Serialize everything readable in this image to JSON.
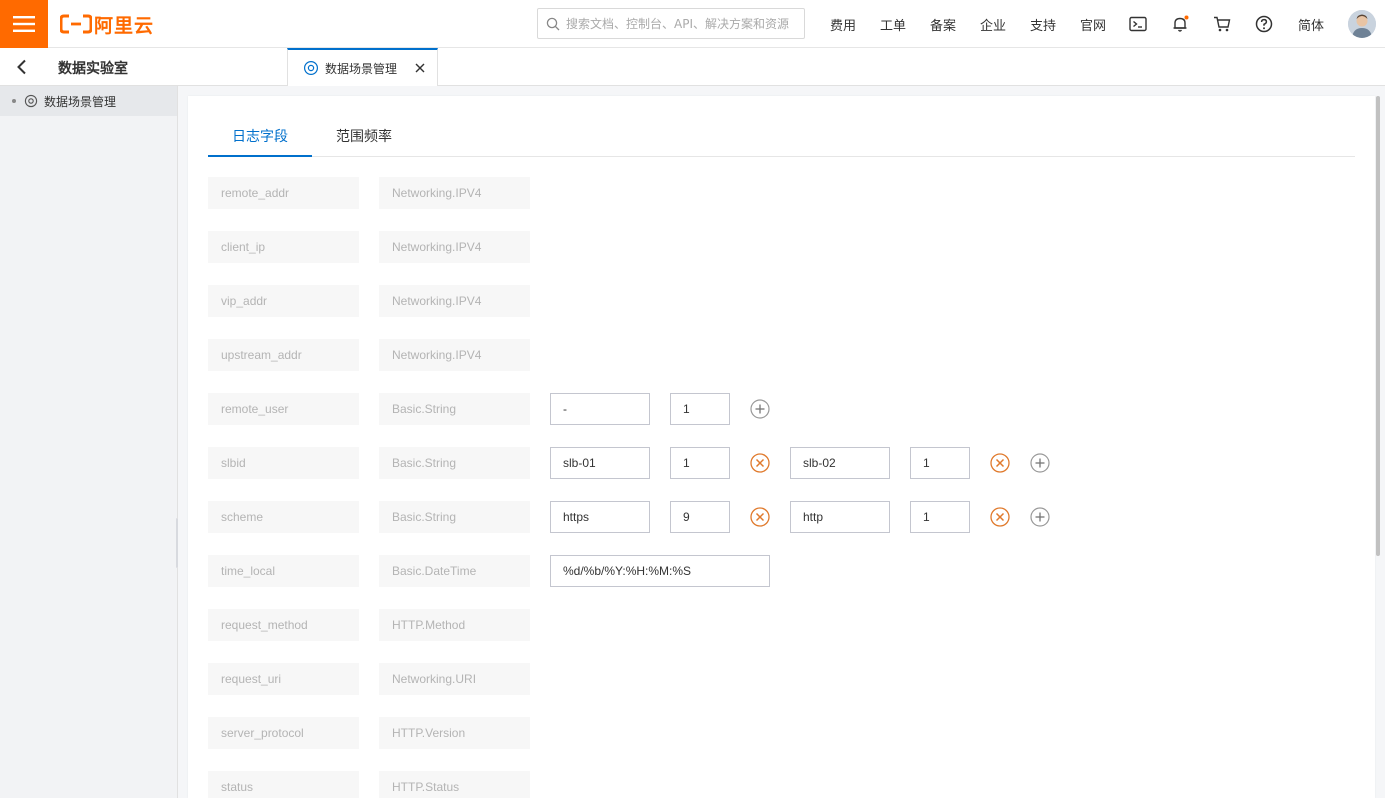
{
  "header": {
    "brand_text": "阿里云",
    "search_placeholder": "搜索文档、控制台、API、解决方案和资源",
    "nav": [
      "费用",
      "工单",
      "备案",
      "企业",
      "支持",
      "官网"
    ],
    "lang": "简体",
    "icons": [
      "menu-icon",
      "search-icon",
      "terminal-icon",
      "bell-icon",
      "cart-icon",
      "help-icon",
      "avatar"
    ],
    "accent_color": "#ff6a00",
    "notify_dot_color": "#ff6a00"
  },
  "subbar": {
    "app_title": "数据实验室",
    "page_tab_label": "数据场景管理"
  },
  "sidebar": {
    "items": [
      {
        "label": "数据场景管理",
        "icon": "scene-icon"
      }
    ]
  },
  "content": {
    "tabs": [
      {
        "label": "日志字段",
        "active": true
      },
      {
        "label": "范围频率",
        "active": false
      }
    ],
    "active_color": "#0070cc",
    "rows": [
      {
        "field": "remote_addr",
        "type": "Networking.IPV4",
        "values": [],
        "add": false
      },
      {
        "field": "client_ip",
        "type": "Networking.IPV4",
        "values": [],
        "add": false
      },
      {
        "field": "vip_addr",
        "type": "Networking.IPV4",
        "values": [],
        "add": false
      },
      {
        "field": "upstream_addr",
        "type": "Networking.IPV4",
        "values": [],
        "add": false
      },
      {
        "field": "remote_user",
        "type": "Basic.String",
        "values": [
          {
            "value": "-",
            "weight": "1",
            "removable": false
          }
        ],
        "add": true
      },
      {
        "field": "slbid",
        "type": "Basic.String",
        "values": [
          {
            "value": "slb-01",
            "weight": "1",
            "removable": true
          },
          {
            "value": "slb-02",
            "weight": "1",
            "removable": true
          }
        ],
        "add": true
      },
      {
        "field": "scheme",
        "type": "Basic.String",
        "values": [
          {
            "value": "https",
            "weight": "9",
            "removable": true
          },
          {
            "value": "http",
            "weight": "1",
            "removable": true
          }
        ],
        "add": true
      },
      {
        "field": "time_local",
        "type": "Basic.DateTime",
        "format": "%d/%b/%Y:%H:%M:%S",
        "values": [],
        "add": false
      },
      {
        "field": "request_method",
        "type": "HTTP.Method",
        "values": [],
        "add": false
      },
      {
        "field": "request_uri",
        "type": "Networking.URI",
        "values": [],
        "add": false
      },
      {
        "field": "server_protocol",
        "type": "HTTP.Version",
        "values": [],
        "add": false
      },
      {
        "field": "status",
        "type": "HTTP.Status",
        "values": [],
        "add": false
      }
    ]
  }
}
